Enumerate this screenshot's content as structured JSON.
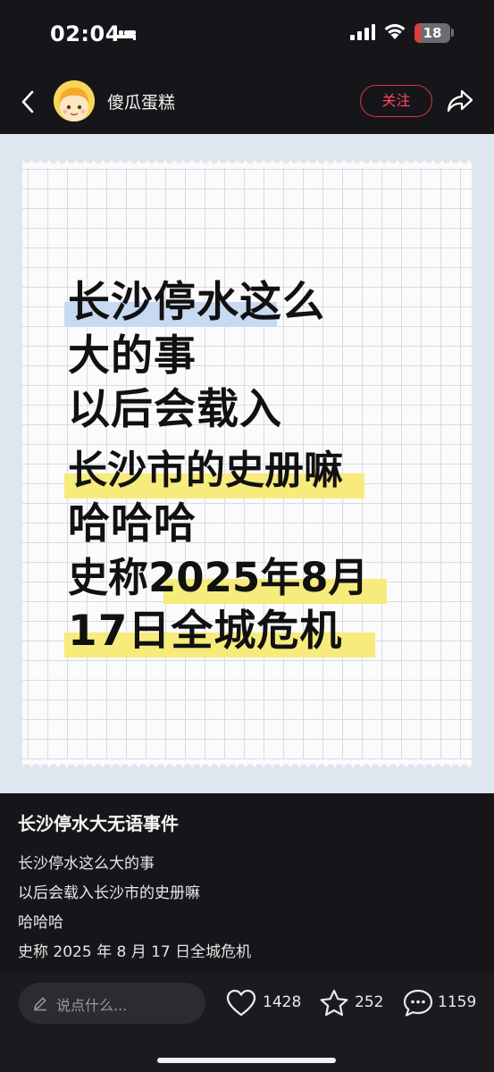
{
  "status_bar": {
    "time": "02:04",
    "battery_level": "18",
    "battery_fraction": 0.18,
    "icons": [
      "bed-icon",
      "signal-icon",
      "wifi-icon",
      "battery-icon"
    ]
  },
  "header": {
    "author_name": "傻瓜蛋糕",
    "follow_label": "关注",
    "icons": [
      "back-icon",
      "avatar",
      "share-icon"
    ]
  },
  "note_image": {
    "lines": [
      "长沙停水这么",
      "大的事",
      "以后会载入",
      "长沙市的史册嘛",
      "哈哈哈",
      "史称2025年8月",
      "17日全城危机"
    ],
    "colors": {
      "paper": "#fbfbfb",
      "grid": "#d7dce3",
      "highlight_blue": "#c8daf2",
      "highlight_yellow": "#f6eb7b",
      "background": "#dfe6ef"
    }
  },
  "post": {
    "title": "长沙停水大无语事件",
    "body_lines": [
      "长沙停水这么大的事",
      "以后会载入长沙市的史册嘛",
      "哈哈哈",
      "史称 2025 年 8 月 17 日全城危机"
    ]
  },
  "bottom_bar": {
    "comment_placeholder": "说点什么...",
    "likes": "1428",
    "favorites": "252",
    "comments": "1159",
    "icons": [
      "pen-icon",
      "heart-icon",
      "star-icon",
      "comment-bubble-icon"
    ]
  },
  "colors": {
    "background": "#16161a",
    "accent": "#e0344a"
  }
}
